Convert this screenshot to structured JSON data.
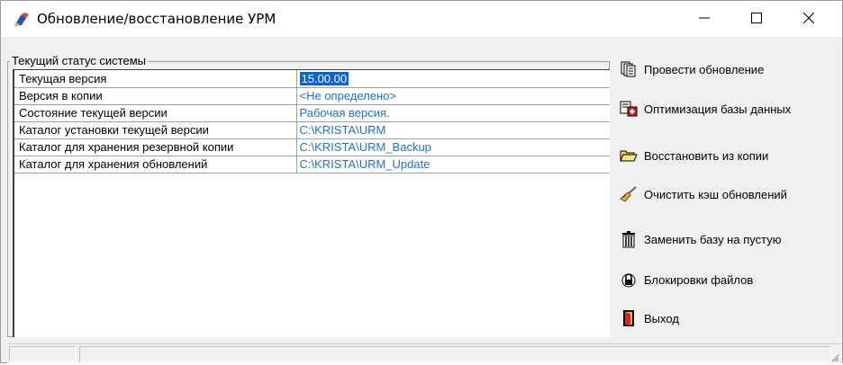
{
  "window": {
    "title": "Обновление/восстановление УРМ",
    "controls": [
      "minimize-icon",
      "maximize-icon",
      "close-icon"
    ]
  },
  "status_group": {
    "label": "Текущий статус системы",
    "rows": [
      {
        "key": "Текущая версия",
        "value": "15.00.00",
        "selected": true
      },
      {
        "key": "Версия в копии",
        "value": "<Не определено>"
      },
      {
        "key": "Состояние текущей версии",
        "value": "Рабочая версия."
      },
      {
        "key": "Каталог установки текущей версии",
        "value": "C:\\KRISTA\\URM"
      },
      {
        "key": "Каталог для хранения резервной копии",
        "value": "C:\\KRISTA\\URM_Backup"
      },
      {
        "key": "Каталог для хранения обновлений",
        "value": "C:\\KRISTA\\URM_Update"
      }
    ]
  },
  "actions": [
    {
      "label": "Провести обновление",
      "icon": "documents-icon"
    },
    {
      "label": "Оптимизация базы данных",
      "icon": "optimize-db-icon"
    },
    {
      "label": "Восстановить из копии",
      "icon": "open-folder-icon"
    },
    {
      "label": "Очистить кэш обновлений",
      "icon": "broom-icon"
    },
    {
      "label": "Заменить базу на пустую",
      "icon": "trash-icon"
    },
    {
      "label": "Блокировки файлов",
      "icon": "lock-icon"
    },
    {
      "label": "Выход",
      "icon": "exit-door-icon"
    }
  ],
  "colors": {
    "value_text": "#1e6fd9",
    "selection": "#0a64d6",
    "window_bg": "#f0f0f0"
  }
}
